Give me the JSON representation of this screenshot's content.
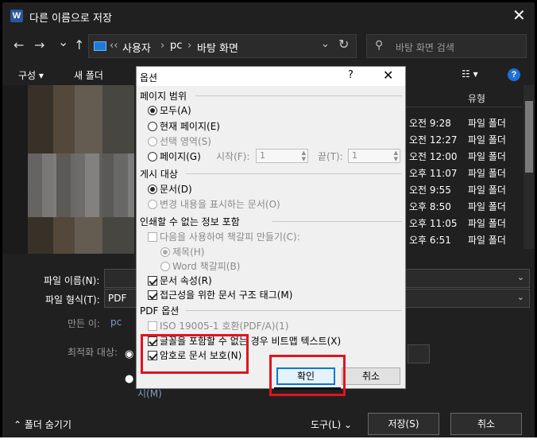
{
  "window": {
    "title": "다른 이름으로 저장",
    "app_icon": "W",
    "close": "✕"
  },
  "nav": {
    "back": "←",
    "forward": "→",
    "recent": "⌄",
    "up": "↑",
    "breadcrumbs": [
      "사용자",
      "pc",
      "바탕 화면"
    ],
    "breadcrumb_sep": "›",
    "overflow": "‹‹",
    "search_placeholder": "바탕 화면 검색"
  },
  "toolbar": {
    "organize": "구성 ▾",
    "new_folder": "새 폴더",
    "help": "?"
  },
  "file_list": {
    "column_type": "유형",
    "rows": [
      {
        "time": "오전 9:28",
        "type": "파일 폴더"
      },
      {
        "time": "오전 12:27",
        "type": "파일 폴더"
      },
      {
        "time": "오전 12:00",
        "type": "파일 폴더"
      },
      {
        "time": "오후 11:07",
        "type": "파일 폴더"
      },
      {
        "time": "오전 9:55",
        "type": "파일 폴더"
      },
      {
        "time": "오후 8:50",
        "type": "파일 폴더"
      },
      {
        "time": "오후 11:05",
        "type": "파일 폴더"
      },
      {
        "time": "오후 6:51",
        "type": "파일 폴더"
      }
    ]
  },
  "form": {
    "filename_label": "파일 이름(N):",
    "filetype_label": "파일 형식(T):",
    "filetype_value": "PDF",
    "author_label": "만든 이:",
    "author_value": "pc",
    "optimize_label": "최적화 대상:",
    "hidden_caption": "시(M)"
  },
  "footer": {
    "hide_folders": "폴더 숨기기",
    "tools": "도구(L)",
    "save": "저장(S)",
    "cancel": "취소"
  },
  "dialog": {
    "title": "옵션",
    "help": "?",
    "close": "✕",
    "page_range": {
      "heading": "페이지 범위",
      "all": "모두(A)",
      "current": "현재 페이지(E)",
      "selection": "선택 영역(S)",
      "pages": "페이지(G)",
      "from_label": "시작(F):",
      "from_value": "1",
      "to_label": "끝(T):",
      "to_value": "1"
    },
    "publish_what": {
      "heading": "게시 대상",
      "document": "문서(D)",
      "markup": "변경 내용을 표시하는 문서(O)"
    },
    "non_printing": {
      "heading": "인쇄할 수 없는 정보 포함",
      "bookmarks": "다음을 사용하여 책갈피 만들기(C):",
      "headings": "제목(H)",
      "word_bookmarks": "Word 책갈피(B)",
      "properties": "문서 속성(R)",
      "structure_tags": "접근성을 위한 문서 구조 태그(M)"
    },
    "pdf_options": {
      "heading": "PDF 옵션",
      "iso": "ISO 19005-1 호환(PDF/A)(1)",
      "bitmap": "글꼴을 포함할 수 없는 경우 비트맵 텍스트(X)",
      "encrypt": "암호로 문서 보호(N)"
    },
    "ok": "확인",
    "cancel": "취소"
  }
}
